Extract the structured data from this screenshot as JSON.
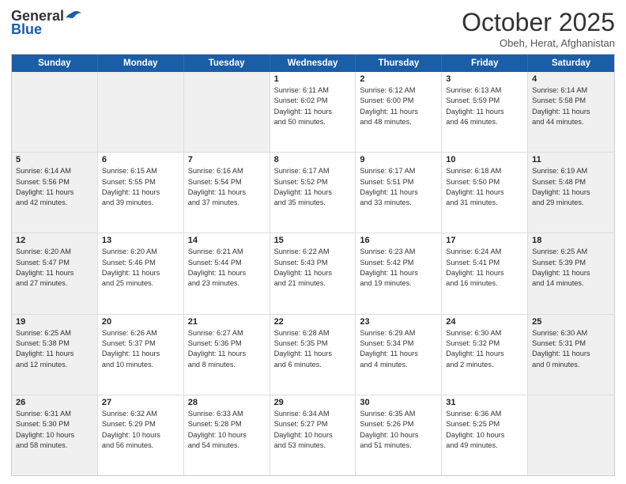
{
  "header": {
    "logo_general": "General",
    "logo_blue": "Blue",
    "title": "October 2025",
    "location": "Obeh, Herat, Afghanistan"
  },
  "days_of_week": [
    "Sunday",
    "Monday",
    "Tuesday",
    "Wednesday",
    "Thursday",
    "Friday",
    "Saturday"
  ],
  "weeks": [
    [
      {
        "day": "",
        "text": "",
        "shaded": true
      },
      {
        "day": "",
        "text": "",
        "shaded": true
      },
      {
        "day": "",
        "text": "",
        "shaded": true
      },
      {
        "day": "1",
        "text": "Sunrise: 6:11 AM\nSunset: 6:02 PM\nDaylight: 11 hours\nand 50 minutes.",
        "shaded": false
      },
      {
        "day": "2",
        "text": "Sunrise: 6:12 AM\nSunset: 6:00 PM\nDaylight: 11 hours\nand 48 minutes.",
        "shaded": false
      },
      {
        "day": "3",
        "text": "Sunrise: 6:13 AM\nSunset: 5:59 PM\nDaylight: 11 hours\nand 46 minutes.",
        "shaded": false
      },
      {
        "day": "4",
        "text": "Sunrise: 6:14 AM\nSunset: 5:58 PM\nDaylight: 11 hours\nand 44 minutes.",
        "shaded": true
      }
    ],
    [
      {
        "day": "5",
        "text": "Sunrise: 6:14 AM\nSunset: 5:56 PM\nDaylight: 11 hours\nand 42 minutes.",
        "shaded": true
      },
      {
        "day": "6",
        "text": "Sunrise: 6:15 AM\nSunset: 5:55 PM\nDaylight: 11 hours\nand 39 minutes.",
        "shaded": false
      },
      {
        "day": "7",
        "text": "Sunrise: 6:16 AM\nSunset: 5:54 PM\nDaylight: 11 hours\nand 37 minutes.",
        "shaded": false
      },
      {
        "day": "8",
        "text": "Sunrise: 6:17 AM\nSunset: 5:52 PM\nDaylight: 11 hours\nand 35 minutes.",
        "shaded": false
      },
      {
        "day": "9",
        "text": "Sunrise: 6:17 AM\nSunset: 5:51 PM\nDaylight: 11 hours\nand 33 minutes.",
        "shaded": false
      },
      {
        "day": "10",
        "text": "Sunrise: 6:18 AM\nSunset: 5:50 PM\nDaylight: 11 hours\nand 31 minutes.",
        "shaded": false
      },
      {
        "day": "11",
        "text": "Sunrise: 6:19 AM\nSunset: 5:48 PM\nDaylight: 11 hours\nand 29 minutes.",
        "shaded": true
      }
    ],
    [
      {
        "day": "12",
        "text": "Sunrise: 6:20 AM\nSunset: 5:47 PM\nDaylight: 11 hours\nand 27 minutes.",
        "shaded": true
      },
      {
        "day": "13",
        "text": "Sunrise: 6:20 AM\nSunset: 5:46 PM\nDaylight: 11 hours\nand 25 minutes.",
        "shaded": false
      },
      {
        "day": "14",
        "text": "Sunrise: 6:21 AM\nSunset: 5:44 PM\nDaylight: 11 hours\nand 23 minutes.",
        "shaded": false
      },
      {
        "day": "15",
        "text": "Sunrise: 6:22 AM\nSunset: 5:43 PM\nDaylight: 11 hours\nand 21 minutes.",
        "shaded": false
      },
      {
        "day": "16",
        "text": "Sunrise: 6:23 AM\nSunset: 5:42 PM\nDaylight: 11 hours\nand 19 minutes.",
        "shaded": false
      },
      {
        "day": "17",
        "text": "Sunrise: 6:24 AM\nSunset: 5:41 PM\nDaylight: 11 hours\nand 16 minutes.",
        "shaded": false
      },
      {
        "day": "18",
        "text": "Sunrise: 6:25 AM\nSunset: 5:39 PM\nDaylight: 11 hours\nand 14 minutes.",
        "shaded": true
      }
    ],
    [
      {
        "day": "19",
        "text": "Sunrise: 6:25 AM\nSunset: 5:38 PM\nDaylight: 11 hours\nand 12 minutes.",
        "shaded": true
      },
      {
        "day": "20",
        "text": "Sunrise: 6:26 AM\nSunset: 5:37 PM\nDaylight: 11 hours\nand 10 minutes.",
        "shaded": false
      },
      {
        "day": "21",
        "text": "Sunrise: 6:27 AM\nSunset: 5:36 PM\nDaylight: 11 hours\nand 8 minutes.",
        "shaded": false
      },
      {
        "day": "22",
        "text": "Sunrise: 6:28 AM\nSunset: 5:35 PM\nDaylight: 11 hours\nand 6 minutes.",
        "shaded": false
      },
      {
        "day": "23",
        "text": "Sunrise: 6:29 AM\nSunset: 5:34 PM\nDaylight: 11 hours\nand 4 minutes.",
        "shaded": false
      },
      {
        "day": "24",
        "text": "Sunrise: 6:30 AM\nSunset: 5:32 PM\nDaylight: 11 hours\nand 2 minutes.",
        "shaded": false
      },
      {
        "day": "25",
        "text": "Sunrise: 6:30 AM\nSunset: 5:31 PM\nDaylight: 11 hours\nand 0 minutes.",
        "shaded": true
      }
    ],
    [
      {
        "day": "26",
        "text": "Sunrise: 6:31 AM\nSunset: 5:30 PM\nDaylight: 10 hours\nand 58 minutes.",
        "shaded": true
      },
      {
        "day": "27",
        "text": "Sunrise: 6:32 AM\nSunset: 5:29 PM\nDaylight: 10 hours\nand 56 minutes.",
        "shaded": false
      },
      {
        "day": "28",
        "text": "Sunrise: 6:33 AM\nSunset: 5:28 PM\nDaylight: 10 hours\nand 54 minutes.",
        "shaded": false
      },
      {
        "day": "29",
        "text": "Sunrise: 6:34 AM\nSunset: 5:27 PM\nDaylight: 10 hours\nand 53 minutes.",
        "shaded": false
      },
      {
        "day": "30",
        "text": "Sunrise: 6:35 AM\nSunset: 5:26 PM\nDaylight: 10 hours\nand 51 minutes.",
        "shaded": false
      },
      {
        "day": "31",
        "text": "Sunrise: 6:36 AM\nSunset: 5:25 PM\nDaylight: 10 hours\nand 49 minutes.",
        "shaded": false
      },
      {
        "day": "",
        "text": "",
        "shaded": true
      }
    ]
  ]
}
